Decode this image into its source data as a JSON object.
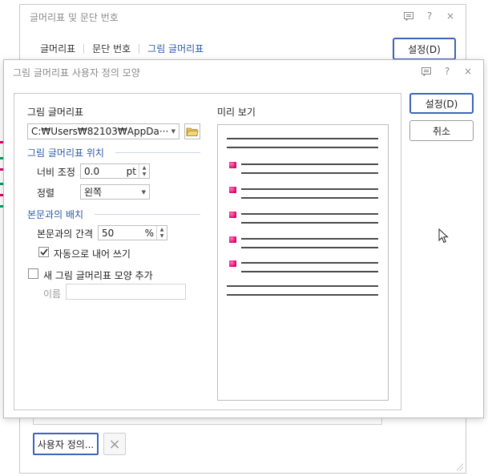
{
  "background_dialog": {
    "title": "글머리표 및 문단 번호",
    "tabs": [
      {
        "label": "글머리표",
        "active": false
      },
      {
        "label": "문단 번호",
        "active": false
      },
      {
        "label": "그림 글머리표",
        "active": true
      }
    ],
    "set_button": "설정(D)",
    "custom_button": "사용자 정의...",
    "delete_icon": "×"
  },
  "titlebar_icons": {
    "comment": "comment-icon",
    "help": "?",
    "close": "×"
  },
  "dialog": {
    "title": "그림 글머리표 사용자 정의 모양",
    "picture_bullet_label": "그림 글머리표",
    "file_path": "C:₩Users₩82103₩AppDa···",
    "position_section": "그림 글머리표 위치",
    "width_label": "너비 조정",
    "width_value": "0.0",
    "width_unit": "pt",
    "align_label": "정렬",
    "align_value": "왼쪽",
    "placement_section": "본문과의 배치",
    "gap_label": "본문과의 간격",
    "gap_value": "50",
    "gap_unit": "%",
    "auto_indent_label": "자동으로 내어 쓰기",
    "auto_indent_checked": true,
    "add_shape_label": "새 그림 글머리표 모양 추가",
    "add_shape_checked": false,
    "name_label": "이름",
    "name_value": "",
    "preview_label": "미리 보기",
    "set_button": "설정(D)",
    "cancel_button": "취소"
  },
  "colors": {
    "accent": "#2a5ba8",
    "button_border": "#3c64b8",
    "bullet": "#e0006a"
  }
}
